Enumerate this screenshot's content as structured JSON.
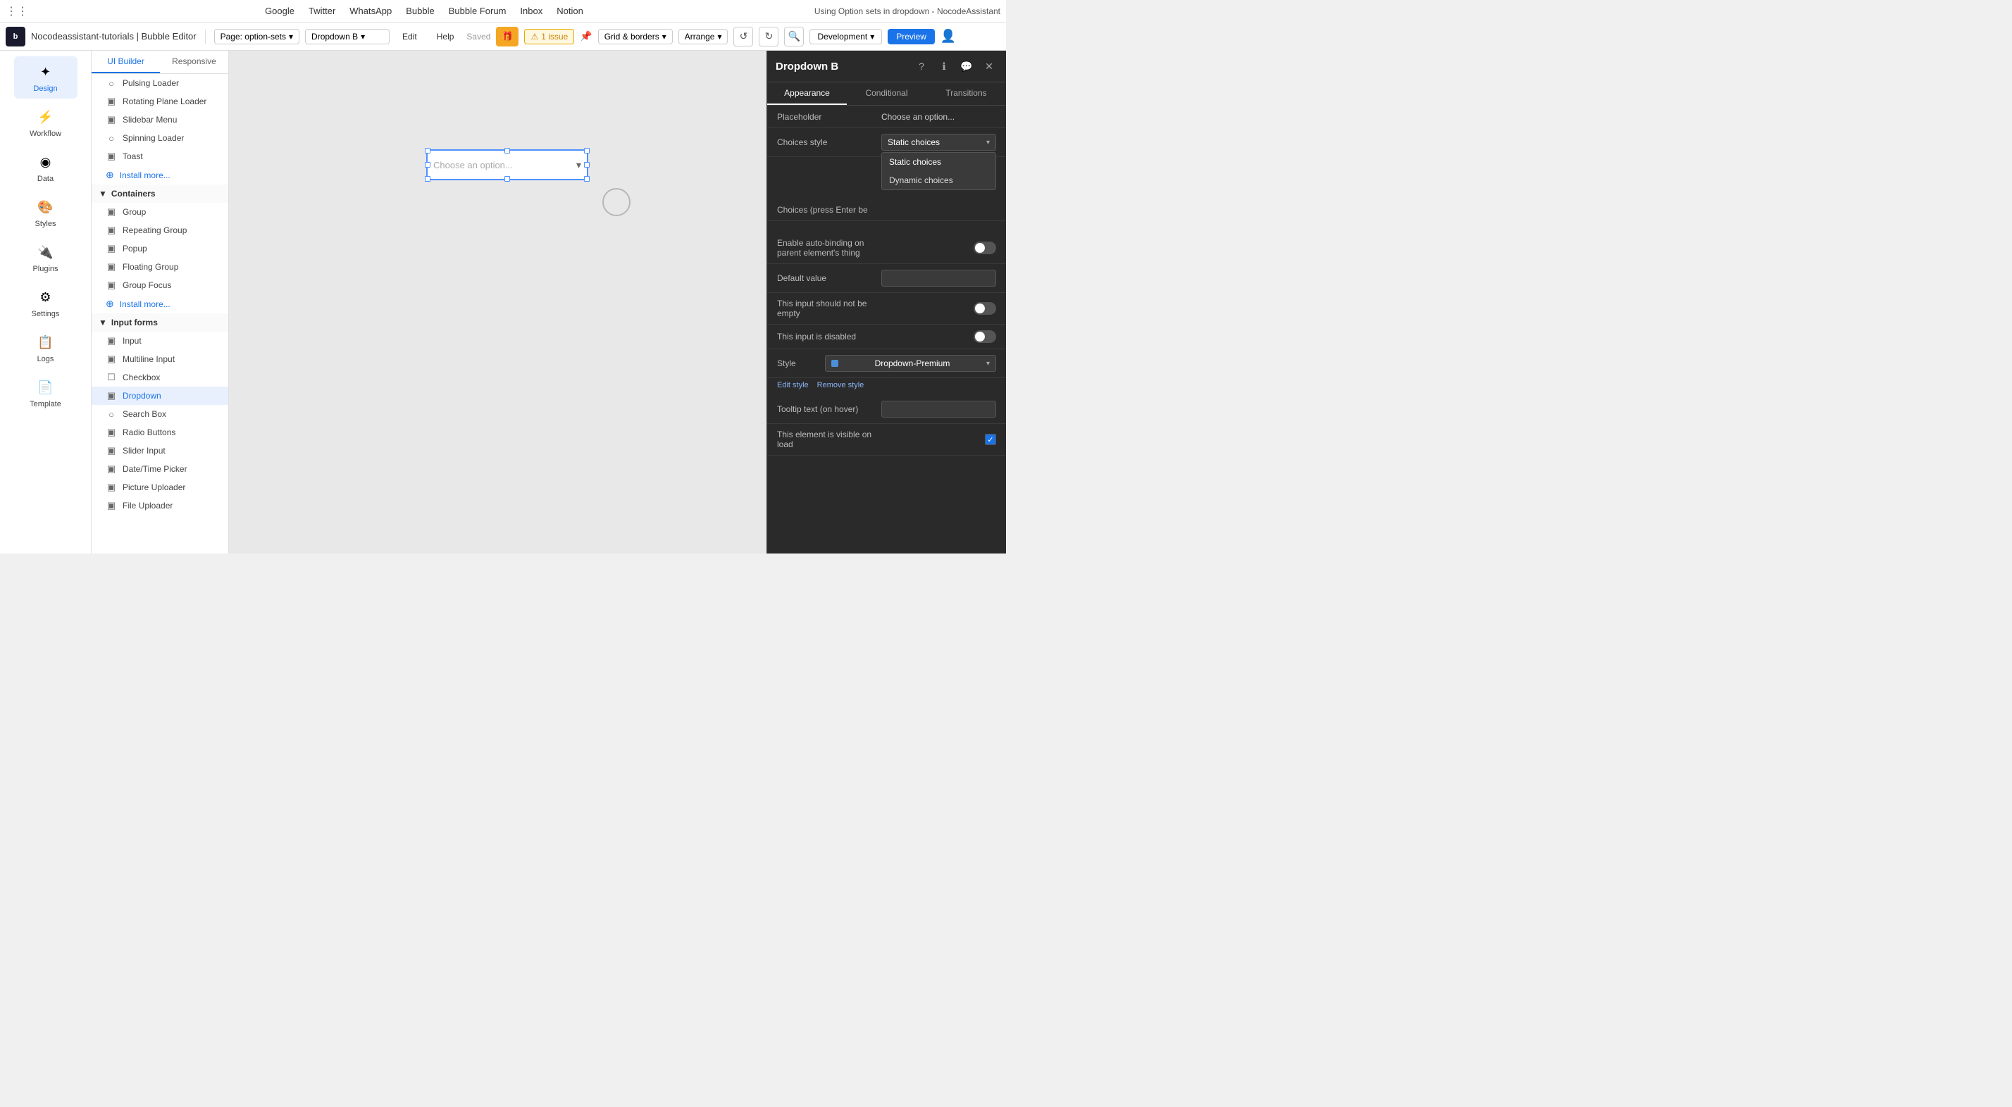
{
  "topBar": {
    "gridDots": "⋮⋮",
    "links": [
      "Google",
      "Twitter",
      "WhatsApp",
      "Bubble",
      "Bubble Forum",
      "Inbox",
      "Notion"
    ],
    "rightTitle": "Using Option sets in dropdown - NocodeAssistant"
  },
  "editorBar": {
    "logoText": "b",
    "editorTitle": "Nocodeassistant-tutorials | Bubble Editor",
    "pageLabel": "Page: option-sets",
    "elementLabel": "Dropdown B",
    "editLabel": "Edit",
    "helpLabel": "Help",
    "savedLabel": "Saved",
    "issueLabel": "1 issue",
    "gridLabel": "Grid & borders",
    "arrangeLabel": "Arrange",
    "devLabel": "Development",
    "previewLabel": "Preview"
  },
  "sidebar": {
    "items": [
      {
        "id": "design",
        "label": "Design",
        "icon": "✦",
        "active": true
      },
      {
        "id": "workflow",
        "label": "Workflow",
        "icon": "⚡"
      },
      {
        "id": "data",
        "label": "Data",
        "icon": "◉"
      },
      {
        "id": "styles",
        "label": "Styles",
        "icon": "🎨"
      },
      {
        "id": "plugins",
        "label": "Plugins",
        "icon": "🔌"
      },
      {
        "id": "settings",
        "label": "Settings",
        "icon": "⚙"
      },
      {
        "id": "logs",
        "label": "Logs",
        "icon": "📋"
      },
      {
        "id": "template",
        "label": "Template",
        "icon": "📄"
      }
    ]
  },
  "panelTabs": [
    "UI Builder",
    "Responsive"
  ],
  "components": {
    "sectionContainersOpen": true,
    "items": [
      {
        "id": "pulsing-loader",
        "label": "Pulsing Loader",
        "icon": "○",
        "indent": true
      },
      {
        "id": "rotating-plane",
        "label": "Rotating Plane Loader",
        "icon": "▣",
        "indent": true
      },
      {
        "id": "slidebar-menu",
        "label": "Slidebar Menu",
        "icon": "▣",
        "indent": true
      },
      {
        "id": "spinning-loader",
        "label": "Spinning Loader",
        "icon": "○",
        "indent": true
      },
      {
        "id": "toast",
        "label": "Toast",
        "icon": "▣",
        "indent": true
      }
    ],
    "containers": {
      "label": "Containers",
      "items": [
        {
          "id": "group",
          "label": "Group",
          "icon": "▣"
        },
        {
          "id": "repeating-group",
          "label": "Repeating Group",
          "icon": "▣"
        },
        {
          "id": "popup",
          "label": "Popup",
          "icon": "▣"
        },
        {
          "id": "floating-group",
          "label": "Floating Group",
          "icon": "▣"
        },
        {
          "id": "group-focus",
          "label": "Group Focus",
          "icon": "▣"
        }
      ]
    },
    "inputForms": {
      "label": "Input forms",
      "items": [
        {
          "id": "input",
          "label": "Input",
          "icon": "▣"
        },
        {
          "id": "multiline-input",
          "label": "Multiline Input",
          "icon": "▣"
        },
        {
          "id": "checkbox",
          "label": "Checkbox",
          "icon": "☐"
        },
        {
          "id": "dropdown",
          "label": "Dropdown",
          "icon": "▣"
        },
        {
          "id": "search-box",
          "label": "Search Box",
          "icon": "○"
        },
        {
          "id": "radio-buttons",
          "label": "Radio Buttons",
          "icon": "▣"
        },
        {
          "id": "slider-input",
          "label": "Slider Input",
          "icon": "▣"
        },
        {
          "id": "datetime-picker",
          "label": "Date/Time Picker",
          "icon": "▣"
        },
        {
          "id": "picture-uploader",
          "label": "Picture Uploader",
          "icon": "▣"
        },
        {
          "id": "file-uploader",
          "label": "File Uploader",
          "icon": "▣"
        }
      ]
    }
  },
  "canvas": {
    "dropdownPlaceholder": "Choose an option..."
  },
  "rightPanel": {
    "title": "Dropdown B",
    "tabs": [
      "Appearance",
      "Conditional",
      "Transitions"
    ],
    "activeTab": "Appearance",
    "placeholder": {
      "label": "Placeholder",
      "value": "Choose an option..."
    },
    "choicesStyle": {
      "label": "Choices style",
      "value": "Static choices",
      "options": [
        "Static choices",
        "Dynamic choices"
      ],
      "open": true
    },
    "choicesInput": {
      "label": "Choices (press Enter be"
    },
    "autobinding": {
      "label": "Enable auto-binding on parent element's thing",
      "enabled": false
    },
    "defaultValue": {
      "label": "Default value",
      "value": ""
    },
    "notEmpty": {
      "label": "This input should not be empty",
      "enabled": false
    },
    "disabled": {
      "label": "This input is disabled",
      "enabled": false
    },
    "style": {
      "label": "Style",
      "value": "Dropdown-Premium",
      "editStyleLabel": "Edit style",
      "removeStyleLabel": "Remove style"
    },
    "tooltipText": {
      "label": "Tooltip text (on hover)",
      "value": ""
    },
    "visibleOnLoad": {
      "label": "This element is visible on load",
      "enabled": true
    }
  }
}
